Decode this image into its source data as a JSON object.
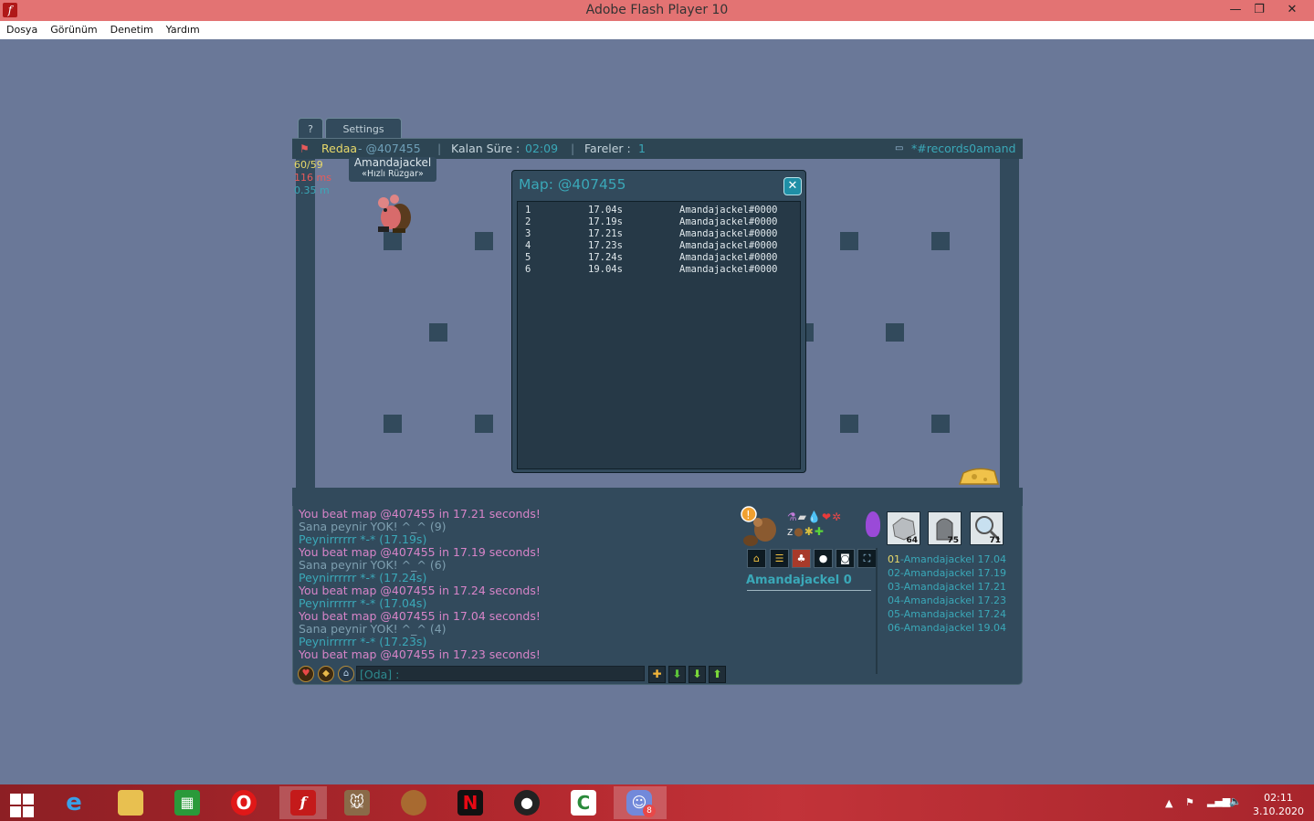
{
  "window": {
    "title": "Adobe Flash Player 10",
    "minimize": "—",
    "restore": "❐",
    "close": "✕"
  },
  "menu": {
    "items": [
      "Dosya",
      "Görünüm",
      "Denetim",
      "Yardım"
    ]
  },
  "game": {
    "tabs": {
      "help": "?",
      "settings": "Settings"
    },
    "topbar": {
      "author": "Redaa",
      "map_code": " - @407455",
      "time_label": "Kalan Süre : ",
      "time_value": "02:09",
      "mice_label": "Fareler : ",
      "mice_value": "1",
      "room": "*#records0amand"
    },
    "hud": {
      "fps": "60/59",
      "ping": "116 ms",
      "distance": "0.35 m"
    },
    "player_tag": {
      "name": "Amandajackel",
      "title": "«Hızlı Rüzgar»"
    }
  },
  "map_dialog": {
    "title": "Map: @407455",
    "close": "✕",
    "records": [
      {
        "rank": "1",
        "time": "17.04s",
        "player": "Amandajackel#0000"
      },
      {
        "rank": "2",
        "time": "17.19s",
        "player": "Amandajackel#0000"
      },
      {
        "rank": "3",
        "time": "17.21s",
        "player": "Amandajackel#0000"
      },
      {
        "rank": "4",
        "time": "17.23s",
        "player": "Amandajackel#0000"
      },
      {
        "rank": "5",
        "time": "17.24s",
        "player": "Amandajackel#0000"
      },
      {
        "rank": "6",
        "time": "19.04s",
        "player": "Amandajackel#0000"
      }
    ]
  },
  "chat": {
    "messages": [
      {
        "text": "You beat map @407455 in 17.21 seconds!",
        "color": "pink"
      },
      {
        "text": "Sana peynir YOK! ^_^ (9)",
        "color": "grey"
      },
      {
        "text": "Peynirrrrrr *-* (17.19s)",
        "color": "teal"
      },
      {
        "text": "You beat map @407455 in 17.19 seconds!",
        "color": "pink"
      },
      {
        "text": "Sana peynir YOK! ^_^ (6)",
        "color": "grey"
      },
      {
        "text": "Peynirrrrrr *-* (17.24s)",
        "color": "teal"
      },
      {
        "text": "You beat map @407455 in 17.24 seconds!",
        "color": "pink"
      },
      {
        "text": "Peynirrrrrr *-* (17.04s)",
        "color": "teal"
      },
      {
        "text": "You beat map @407455 in 17.04 seconds!",
        "color": "pink"
      },
      {
        "text": "Sana peynir YOK! ^_^ (4)",
        "color": "grey"
      },
      {
        "text": "Peynirrrrrr *-* (17.23s)",
        "color": "teal"
      },
      {
        "text": "You beat map @407455 in 17.23 seconds!",
        "color": "pink"
      }
    ],
    "input_value": "[Oda] :"
  },
  "side_panel": {
    "player_label": "Amandajackel 0",
    "tools": [
      {
        "count": "64"
      },
      {
        "count": "75"
      },
      {
        "count": "71"
      }
    ],
    "records": [
      {
        "num": "01",
        "text": "-Amandajackel 17.04"
      },
      {
        "num": "02",
        "text": "-Amandajackel 17.19"
      },
      {
        "num": "03",
        "text": "-Amandajackel 17.21"
      },
      {
        "num": "04",
        "text": "-Amandajackel 17.23"
      },
      {
        "num": "05",
        "text": "-Amandajackel 17.24"
      },
      {
        "num": "06",
        "text": "-Amandajackel 19.04"
      }
    ]
  },
  "taskbar": {
    "badge_discord": "8",
    "clock_time": "02:11",
    "clock_date": "3.10.2020"
  },
  "colors": {
    "panel": "#324a5c",
    "stage": "#6a7898",
    "accent": "#3aa8b8",
    "chat_pink": "#d784c8"
  }
}
